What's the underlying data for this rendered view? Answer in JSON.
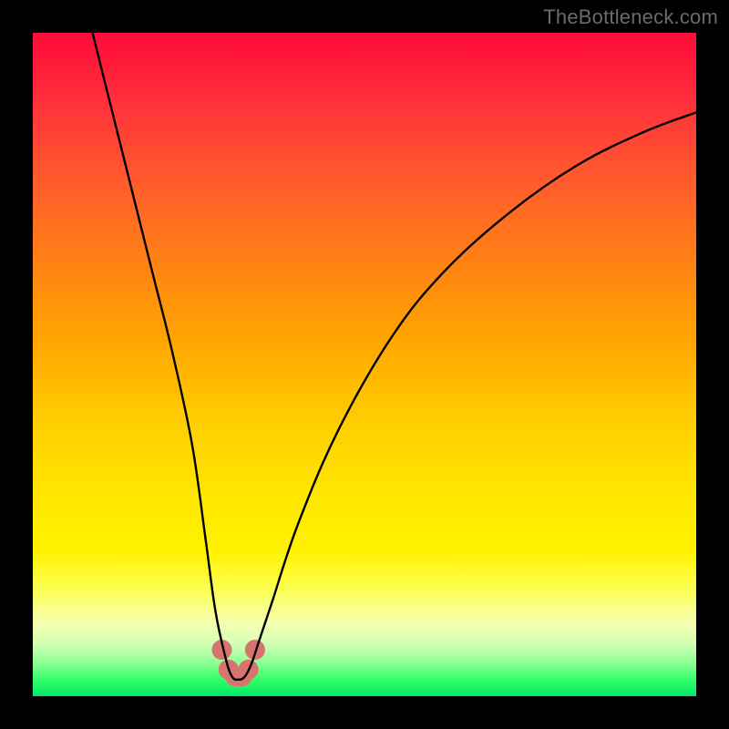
{
  "watermark": "TheBottleneck.com",
  "chart_data": {
    "type": "line",
    "title": "",
    "xlabel": "",
    "ylabel": "",
    "xlim": [
      0,
      100
    ],
    "ylim": [
      0,
      100
    ],
    "series": [
      {
        "name": "curve",
        "x": [
          9,
          12,
          15,
          18,
          21,
          24,
          26,
          27.5,
          29,
          30,
          31,
          32,
          33,
          34,
          36,
          40,
          46,
          54,
          62,
          72,
          82,
          92,
          100
        ],
        "values": [
          100,
          88,
          76,
          64,
          52,
          38,
          24,
          13,
          6,
          3,
          2.5,
          3,
          5,
          8,
          14,
          26,
          40,
          54,
          64,
          73,
          80,
          85,
          88
        ]
      }
    ],
    "markers": [
      {
        "x": 28.5,
        "y": 7
      },
      {
        "x": 29.5,
        "y": 4
      },
      {
        "x": 30.5,
        "y": 3
      },
      {
        "x": 31.5,
        "y": 3
      },
      {
        "x": 32.5,
        "y": 4
      },
      {
        "x": 33.5,
        "y": 7
      }
    ],
    "colors": {
      "curve": "#000000",
      "marker": "#d9736e",
      "gradient_top": "#ff0b3a",
      "gradient_bottom": "#00e66a"
    }
  }
}
